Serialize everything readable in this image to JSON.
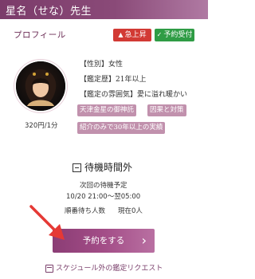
{
  "header": {
    "title": "星名（せな）先生"
  },
  "profile": {
    "label": "プロフィール"
  },
  "badges": [
    {
      "icon": "rising-icon",
      "text": "急上昇"
    },
    {
      "icon": "check-icon",
      "text": "予約受付中"
    }
  ],
  "price": "320円/1分",
  "info": {
    "gender_key": "【性別】",
    "gender": "女性",
    "career_key": "【鑑定歴】",
    "career": "21年以上",
    "atmosphere_key": "【鑑定の雰囲気】",
    "atmosphere": "愛に溢れ暖かい"
  },
  "tags": [
    "天津金星の御神託",
    "因果と対策",
    "紹介のみで30年以上の実績"
  ],
  "waiting": {
    "title": "待機時間外",
    "next_label": "次回の待機予定",
    "next_time": "10/20 21:00～翌05:00",
    "queue_label": "順番待ち人数",
    "queue_value": "現在0人"
  },
  "actions": {
    "reserve": "予約をする",
    "request": "スケジュール外の鑑定リクエスト"
  },
  "colors": {
    "brand": "#7b3b6a",
    "accent": "#a34d87",
    "tag": "#c191ad",
    "rising": "#d23a34",
    "open": "#2f9c45",
    "arrow": "#e53935"
  }
}
